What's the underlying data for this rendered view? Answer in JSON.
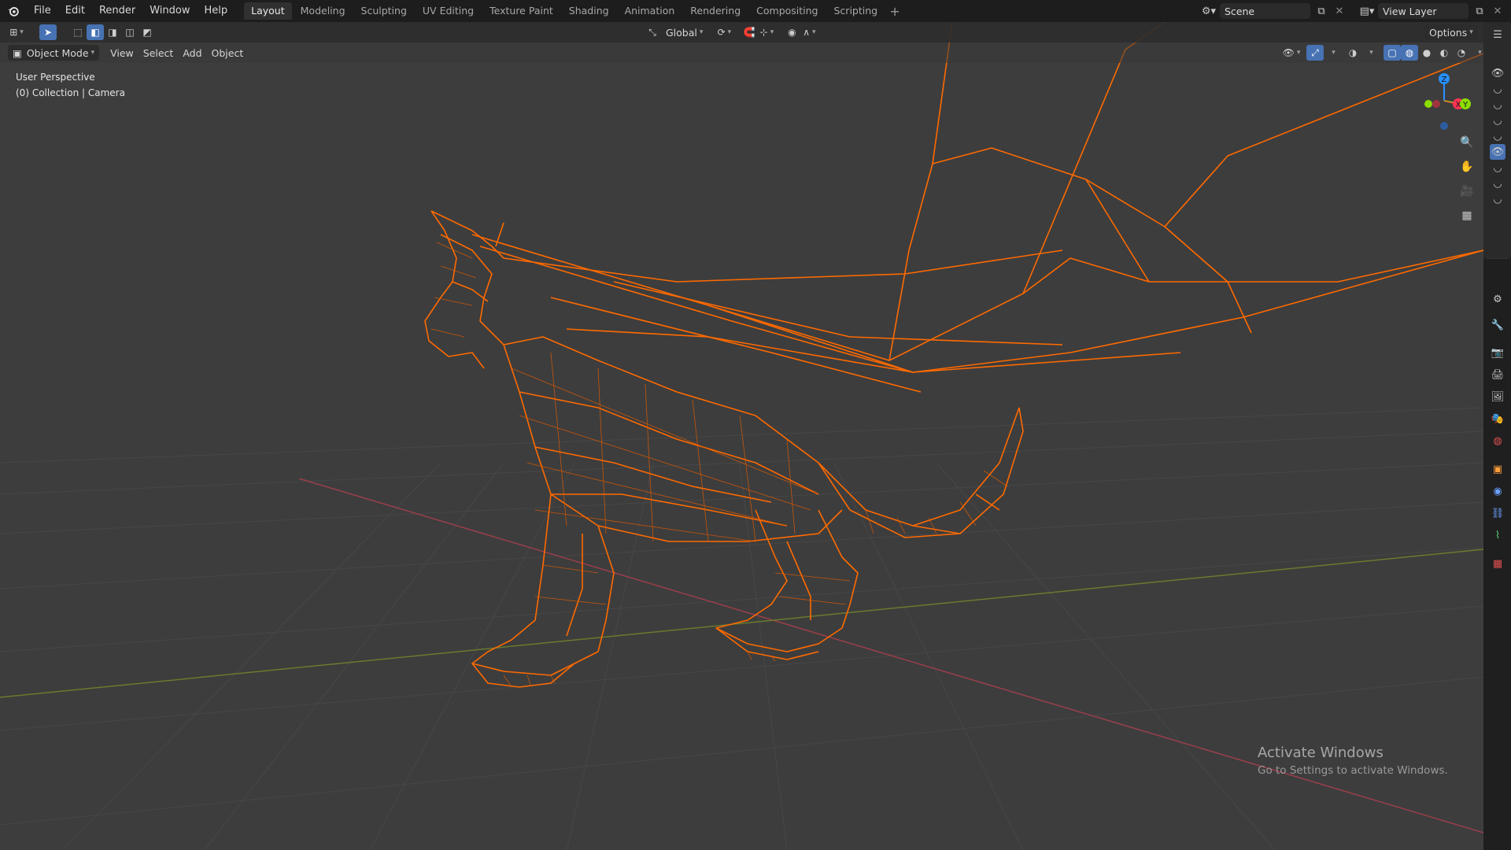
{
  "menu": {
    "items": [
      "File",
      "Edit",
      "Render",
      "Window",
      "Help"
    ]
  },
  "workspaces": {
    "tabs": [
      "Layout",
      "Modeling",
      "Sculpting",
      "UV Editing",
      "Texture Paint",
      "Shading",
      "Animation",
      "Rendering",
      "Compositing",
      "Scripting"
    ],
    "active": "Layout",
    "add_label": "+"
  },
  "scene": {
    "name": "Scene",
    "view_layer": "View Layer"
  },
  "viewport_header": {
    "mode": "Object Mode",
    "menus": [
      "View",
      "Select",
      "Add",
      "Object"
    ],
    "transform_orientation": "Global",
    "options_label": "Options"
  },
  "view_info": {
    "perspective": "User Perspective",
    "collection": "(0) Collection | Camera"
  },
  "gizmo": {
    "axes": [
      "Z",
      "X",
      "Y"
    ],
    "colors": {
      "x": "#ff3352",
      "y": "#8bdc00",
      "z": "#2890ff"
    }
  },
  "watermark": {
    "title": "Activate Windows",
    "subtitle": "Go to Settings to activate Windows."
  },
  "colors": {
    "wireframe": "#ff6a00",
    "viewport_bg": "#3d3d3d",
    "accent": "#4772b3"
  },
  "icons": {
    "nav": [
      "zoom-icon",
      "pan-hand-icon",
      "camera-view-icon",
      "ortho-grid-icon"
    ],
    "properties": [
      "tool-icon",
      "render-icon",
      "output-icon",
      "view-layer-icon",
      "scene-icon",
      "world-icon",
      "object-icon",
      "modifier-icon",
      "particles-icon",
      "physics-icon",
      "constraints-icon",
      "data-icon",
      "material-icon",
      "texture-icon"
    ]
  }
}
